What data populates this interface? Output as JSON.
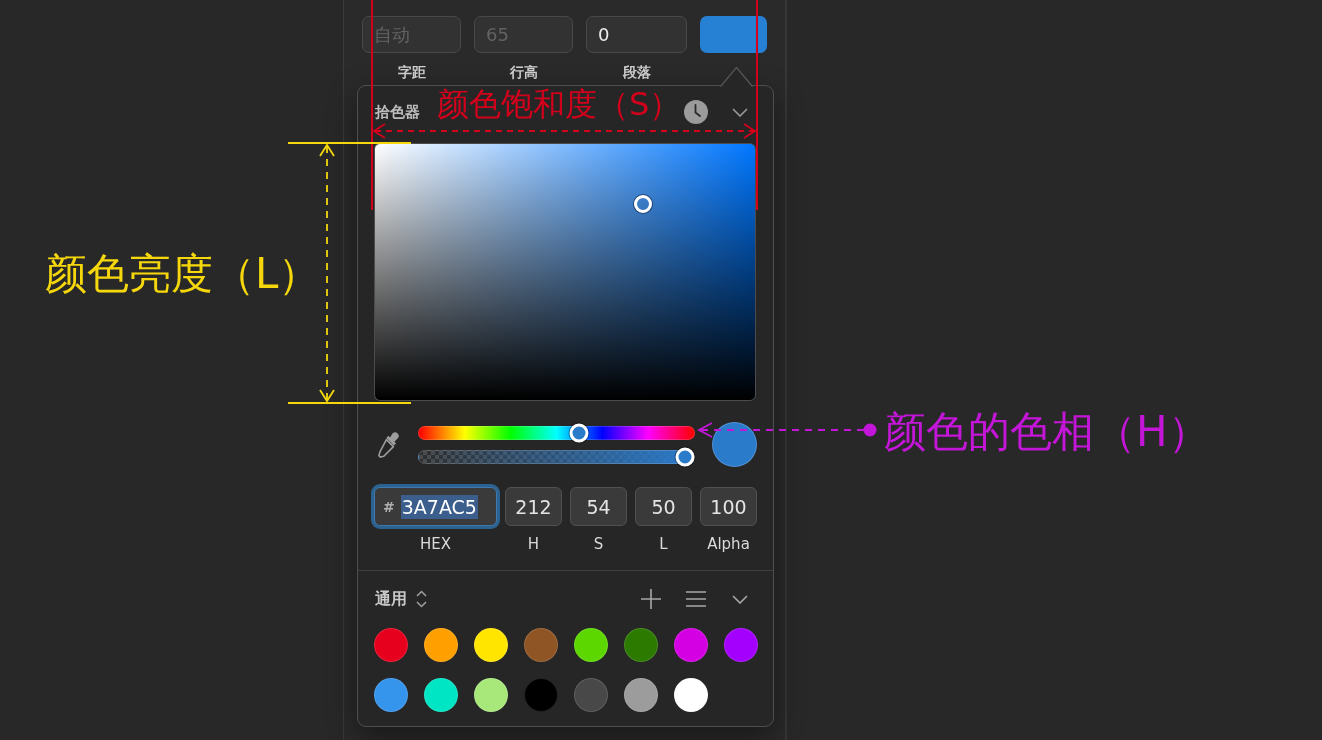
{
  "typography": {
    "fields": [
      {
        "label": "字距",
        "placeholder": "自动"
      },
      {
        "label": "行高",
        "placeholder": "65"
      },
      {
        "label": "段落",
        "value": "0"
      }
    ],
    "text_color": {
      "color": "#2680d4"
    }
  },
  "color_picker": {
    "title": "拾色器",
    "color_area": {
      "saturation": {
        "level": 0.704
      },
      "brightness": {
        "level": 0.767
      }
    },
    "hue": {
      "level": 0.589
    },
    "alpha": {
      "level": 1
    },
    "preview": {
      "color": "#2b7bcb"
    },
    "fields": [
      {
        "kind": "hex",
        "prefix": "#",
        "value": "3A7AC5",
        "label": "HEX",
        "focused": true
      },
      {
        "kind": "number",
        "value": "212",
        "label": "H",
        "focused": false
      },
      {
        "kind": "number",
        "value": "54",
        "label": "S",
        "focused": false
      },
      {
        "kind": "number",
        "value": "50",
        "label": "L",
        "focused": false
      },
      {
        "kind": "number",
        "value": "100",
        "label": "Alpha",
        "focused": false
      }
    ],
    "palette": {
      "title": "通用",
      "swatches": [
        {
          "color": "#e6001e"
        },
        {
          "color": "#ffa000"
        },
        {
          "color": "#ffe500"
        },
        {
          "color": "#8f5524"
        },
        {
          "color": "#5cd800"
        },
        {
          "color": "#2d7a00"
        },
        {
          "color": "#d400e3"
        },
        {
          "color": "#a300fd"
        },
        {
          "color": "#3594ec"
        },
        {
          "color": "#00e5c3"
        },
        {
          "color": "#a8e87b"
        },
        {
          "color": "#000000"
        },
        {
          "color": "#484848"
        },
        {
          "color": "#9c9c9c"
        },
        {
          "color": "#ffffff"
        }
      ]
    }
  },
  "annotations": [
    {
      "kind": "horizontal_span",
      "text": "颜色饱和度（S）",
      "color": "#d3001c"
    },
    {
      "kind": "vertical_span",
      "text": "颜色亮度（L）",
      "color": "#f5d70c"
    },
    {
      "kind": "pointer",
      "text": "颜色的色相（H）",
      "color": "#c416d8"
    }
  ]
}
